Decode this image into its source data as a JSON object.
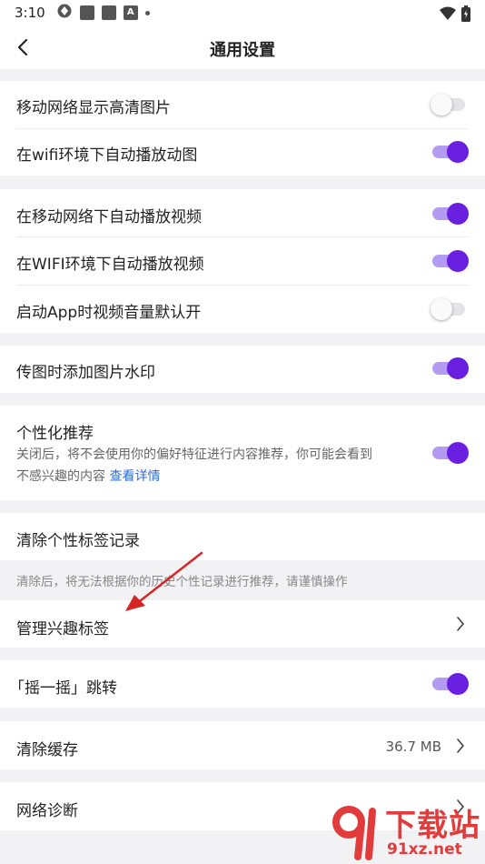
{
  "status_bar": {
    "time": "3:10",
    "icons": [
      "vpn-icon",
      "app-square-icon",
      "app-square-icon",
      "a-badge-icon",
      "dot-icon"
    ],
    "a_badge": "A",
    "right_icons": [
      "wifi-icon",
      "battery-icon"
    ]
  },
  "nav": {
    "title": "通用设置",
    "back_icon": "chevron-left-icon"
  },
  "settings": {
    "mobile_hd_images": {
      "label": "移动网络显示高清图片",
      "enabled": false
    },
    "wifi_autoplay_gif": {
      "label": "在wifi环境下自动播放动图",
      "enabled": true
    },
    "mobile_autoplay_video": {
      "label": "在移动网络下自动播放视频",
      "enabled": true
    },
    "wifi_autoplay_video": {
      "label": "在WIFI环境下自动播放视频",
      "enabled": true
    },
    "app_start_video_sound": {
      "label": "启动App时视频音量默认开",
      "enabled": false
    },
    "upload_watermark": {
      "label": "传图时添加图片水印",
      "enabled": true
    },
    "personalized": {
      "label": "个性化推荐",
      "enabled": true,
      "description_line1": "关闭后，将不会使用你的偏好特征进行内容推荐，你可能会看到",
      "description_line2": "不感兴趣的内容",
      "link": "查看详情"
    },
    "clear_tags": {
      "label": "清除个性标签记录"
    },
    "clear_tags_hint": "清除后，将无法根据你的历史个性记录进行推荐，请谨慎操作",
    "manage_interest_tags": {
      "label": "管理兴趣标签"
    },
    "shake_jump": {
      "label": "「摇一摇」跳转",
      "enabled": true
    },
    "clear_cache": {
      "label": "清除缓存",
      "value": "36.7 MB"
    },
    "network_diagnosis": {
      "label": "网络诊断"
    }
  },
  "colors": {
    "toggle_on_knob": "#6a1fe0",
    "toggle_on_track": "#b49bf2",
    "link": "#2f6bd8",
    "background": "#f2f2f5",
    "annotation_arrow": "#d62525"
  },
  "watermark": {
    "text_main": "下载站",
    "text_sub": "91xz.net"
  }
}
